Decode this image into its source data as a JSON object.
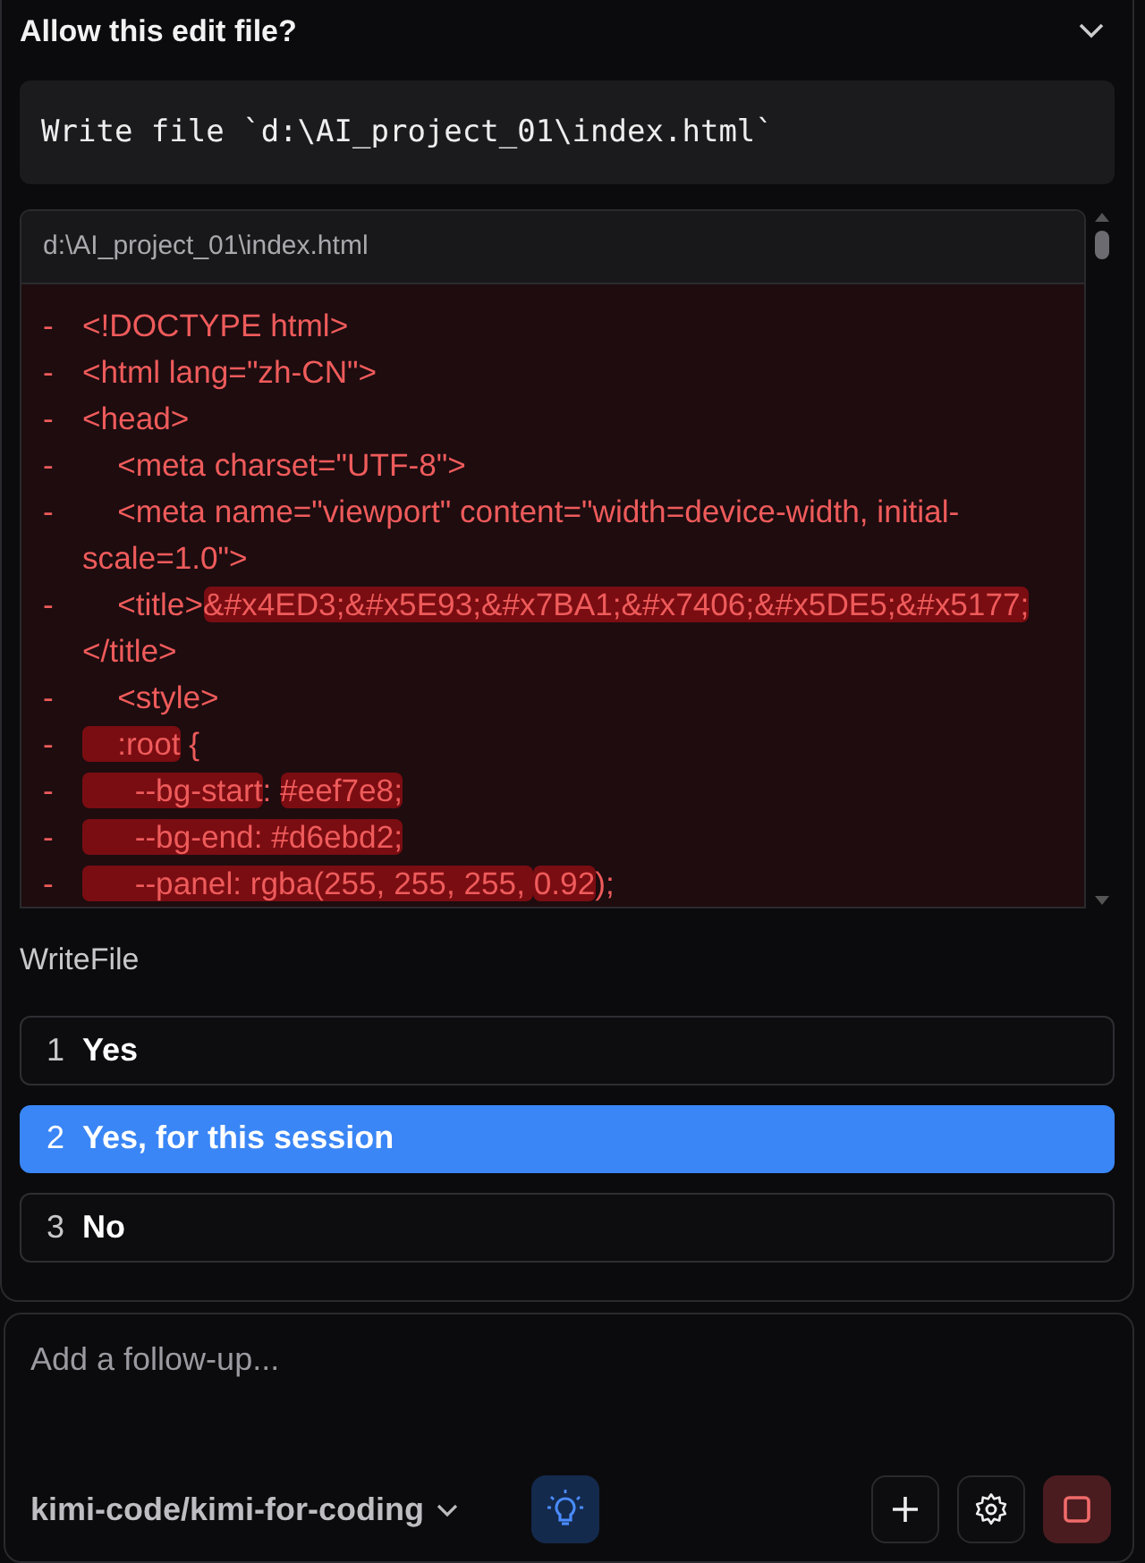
{
  "prompt": {
    "title": "Allow this edit file?",
    "expanded": true
  },
  "command": "Write file `d:\\AI_project_01\\index.html`",
  "diff": {
    "path": "d:\\AI_project_01\\index.html",
    "lines": [
      {
        "marker": "-",
        "segments": [
          {
            "text": "<!DOCTYPE html>",
            "highlight": false
          }
        ]
      },
      {
        "marker": "-",
        "segments": [
          {
            "text": "<html lang=\"zh-CN\">",
            "highlight": false
          }
        ]
      },
      {
        "marker": "-",
        "segments": [
          {
            "text": "<head>",
            "highlight": false
          }
        ]
      },
      {
        "marker": "-",
        "segments": [
          {
            "text": "    <meta charset=\"UTF-8\">",
            "highlight": false
          }
        ]
      },
      {
        "marker": "-",
        "segments": [
          {
            "text": "    <meta name=\"viewport\" content=\"width=device-width, initial-scale=1.0\">",
            "highlight": false
          }
        ]
      },
      {
        "marker": "-",
        "segments": [
          {
            "text": "    <title>",
            "highlight": false
          },
          {
            "text": "&#x4ED3;&#x5E93;&#x7BA1;&#x7406;&#x5DE5;&#x5177;",
            "highlight": true
          },
          {
            "text": "</title>",
            "highlight": false
          }
        ]
      },
      {
        "marker": "-",
        "segments": [
          {
            "text": "    <style>",
            "highlight": false
          }
        ]
      },
      {
        "marker": "-",
        "segments": [
          {
            "text": "    :root",
            "highlight": true
          },
          {
            "text": " {",
            "highlight": false
          }
        ]
      },
      {
        "marker": "-",
        "segments": [
          {
            "text": "      --bg-start",
            "highlight": true
          },
          {
            "text": ": ",
            "highlight": false
          },
          {
            "text": "#eef7e8;",
            "highlight": true
          }
        ]
      },
      {
        "marker": "-",
        "segments": [
          {
            "text": "      --bg-end: #d6ebd2;",
            "highlight": true
          }
        ]
      },
      {
        "marker": "-",
        "segments": [
          {
            "text": "      --panel: rgba(255, 255, 255, ",
            "highlight": true
          },
          {
            "text": "0.92",
            "highlight": true
          },
          {
            "text": ");",
            "highlight": false
          }
        ]
      }
    ]
  },
  "tool_name": "WriteFile",
  "options": [
    {
      "number": "1",
      "label": "Yes",
      "selected": false
    },
    {
      "number": "2",
      "label": "Yes, for this session",
      "selected": true
    },
    {
      "number": "3",
      "label": "No",
      "selected": false
    }
  ],
  "composer": {
    "placeholder": "Add a follow-up...",
    "model": "kimi-code/kimi-for-coding",
    "thinking_on": true
  }
}
